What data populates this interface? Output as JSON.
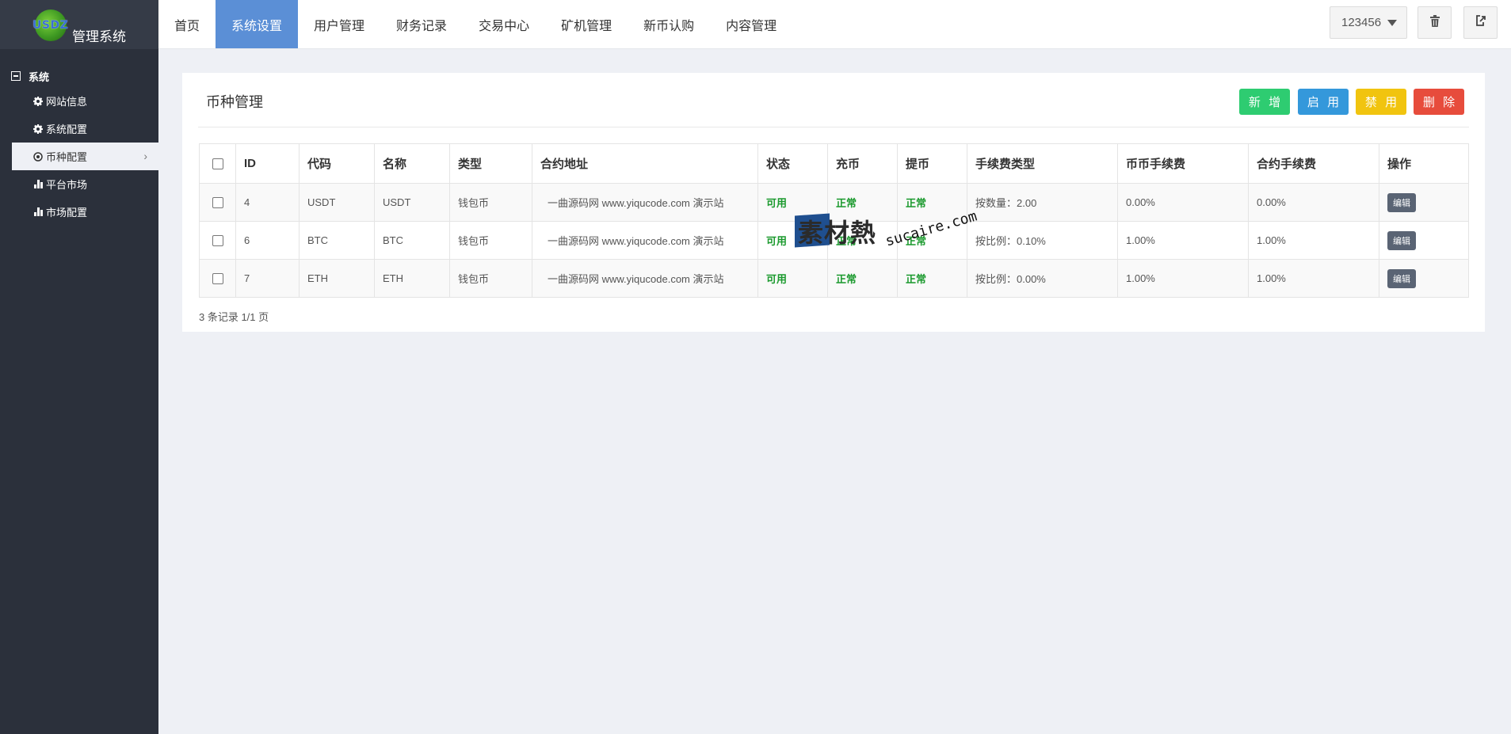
{
  "app": {
    "logo_mark": "USDZ",
    "title": "管理系统"
  },
  "sidebar": {
    "group_title": "系统",
    "items": [
      {
        "label": "网站信息",
        "icon": "gear-icon"
      },
      {
        "label": "系统配置",
        "icon": "gear-icon"
      },
      {
        "label": "币种配置",
        "icon": "circle-dot-icon",
        "active": true
      },
      {
        "label": "平台市场",
        "icon": "bar-chart-icon"
      },
      {
        "label": "市场配置",
        "icon": "bar-chart-icon"
      }
    ]
  },
  "topnav": {
    "tabs": [
      {
        "label": "首页"
      },
      {
        "label": "系统设置",
        "active": true
      },
      {
        "label": "用户管理"
      },
      {
        "label": "财务记录"
      },
      {
        "label": "交易中心"
      },
      {
        "label": "矿机管理"
      },
      {
        "label": "新币认购"
      },
      {
        "label": "内容管理"
      }
    ],
    "user": "123456",
    "trash_icon": "trash-icon",
    "logout_icon": "logout-icon"
  },
  "panel": {
    "title": "币种管理",
    "buttons": {
      "add": "新 增",
      "enable": "启 用",
      "disable": "禁 用",
      "delete": "删 除"
    },
    "columns": [
      "ID",
      "代码",
      "名称",
      "类型",
      "合约地址",
      "状态",
      "充币",
      "提币",
      "手续费类型",
      "币币手续费",
      "合约手续费",
      "操作"
    ],
    "rows": [
      {
        "id": "4",
        "code": "USDT",
        "name": "USDT",
        "type": "钱包币",
        "address": "一曲源码网 www.yiqucode.com 演示站",
        "status": "可用",
        "deposit": "正常",
        "withdraw": "正常",
        "fee_type": "按数量：2.00",
        "spot_fee": "0.00%",
        "contract_fee": "0.00%",
        "action": "编辑"
      },
      {
        "id": "6",
        "code": "BTC",
        "name": "BTC",
        "type": "钱包币",
        "address": "一曲源码网 www.yiqucode.com 演示站",
        "status": "可用",
        "deposit": "正常",
        "withdraw": "正常",
        "fee_type": "按比例：0.10%",
        "spot_fee": "1.00%",
        "contract_fee": "1.00%",
        "action": "编辑"
      },
      {
        "id": "7",
        "code": "ETH",
        "name": "ETH",
        "type": "钱包币",
        "address": "一曲源码网 www.yiqucode.com 演示站",
        "status": "可用",
        "deposit": "正常",
        "withdraw": "正常",
        "fee_type": "按比例：0.00%",
        "spot_fee": "1.00%",
        "contract_fee": "1.00%",
        "action": "编辑"
      }
    ],
    "footer": "3 条记录 1/1 页"
  },
  "watermark": {
    "cn": "素材熱",
    "en": "sucaire.com"
  },
  "colors": {
    "sidebar_bg": "#2b303b",
    "active_tab": "#5b8fd6",
    "btn_add": "#2ecc71",
    "btn_enable": "#3498db",
    "btn_disable": "#f1c40f",
    "btn_delete": "#e74c3c",
    "status_green": "#1b9a2e"
  }
}
